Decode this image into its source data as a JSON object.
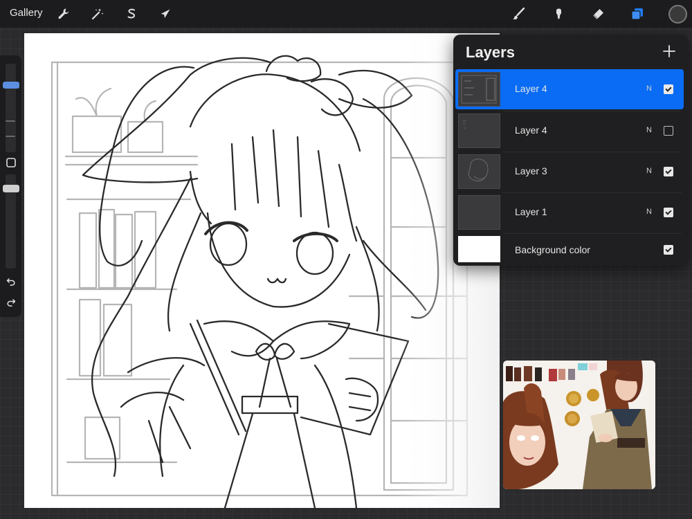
{
  "toolbar": {
    "gallery_label": "Gallery",
    "left_tools": [
      {
        "icon": "wrench-icon",
        "name": "actions-button"
      },
      {
        "icon": "magic-wand-icon",
        "name": "adjustments-button"
      },
      {
        "icon": "selection-s-icon",
        "name": "selection-button"
      },
      {
        "icon": "arrow-cursor-icon",
        "name": "transform-button"
      }
    ],
    "right_tools": [
      {
        "icon": "brush-icon",
        "name": "brush-button"
      },
      {
        "icon": "smudge-icon",
        "name": "smudge-button"
      },
      {
        "icon": "eraser-icon",
        "name": "eraser-button"
      },
      {
        "icon": "layers-icon",
        "name": "layers-button",
        "active": true
      }
    ],
    "accent_color": "#1f7cf2",
    "current_color": "#3a3a3a"
  },
  "sidebar": {
    "brush_size_level": 0.1,
    "opacity_level": 0.35,
    "modify_icon": "square-icon",
    "undo_icon": "undo-icon",
    "redo_icon": "redo-icon"
  },
  "layers": {
    "title": "Layers",
    "add_icon": "plus-icon",
    "items": [
      {
        "name": "Layer 4",
        "mode": "N",
        "visible": true,
        "active": true
      },
      {
        "name": "Layer 4",
        "mode": "N",
        "visible": false,
        "active": false
      },
      {
        "name": "Layer 3",
        "mode": "N",
        "visible": true,
        "active": false
      },
      {
        "name": "Layer 1",
        "mode": "N",
        "visible": true,
        "active": false
      }
    ],
    "background": {
      "name": "Background color",
      "visible": true,
      "color": "#ffffff"
    },
    "active_color": "#0a6cf5"
  }
}
